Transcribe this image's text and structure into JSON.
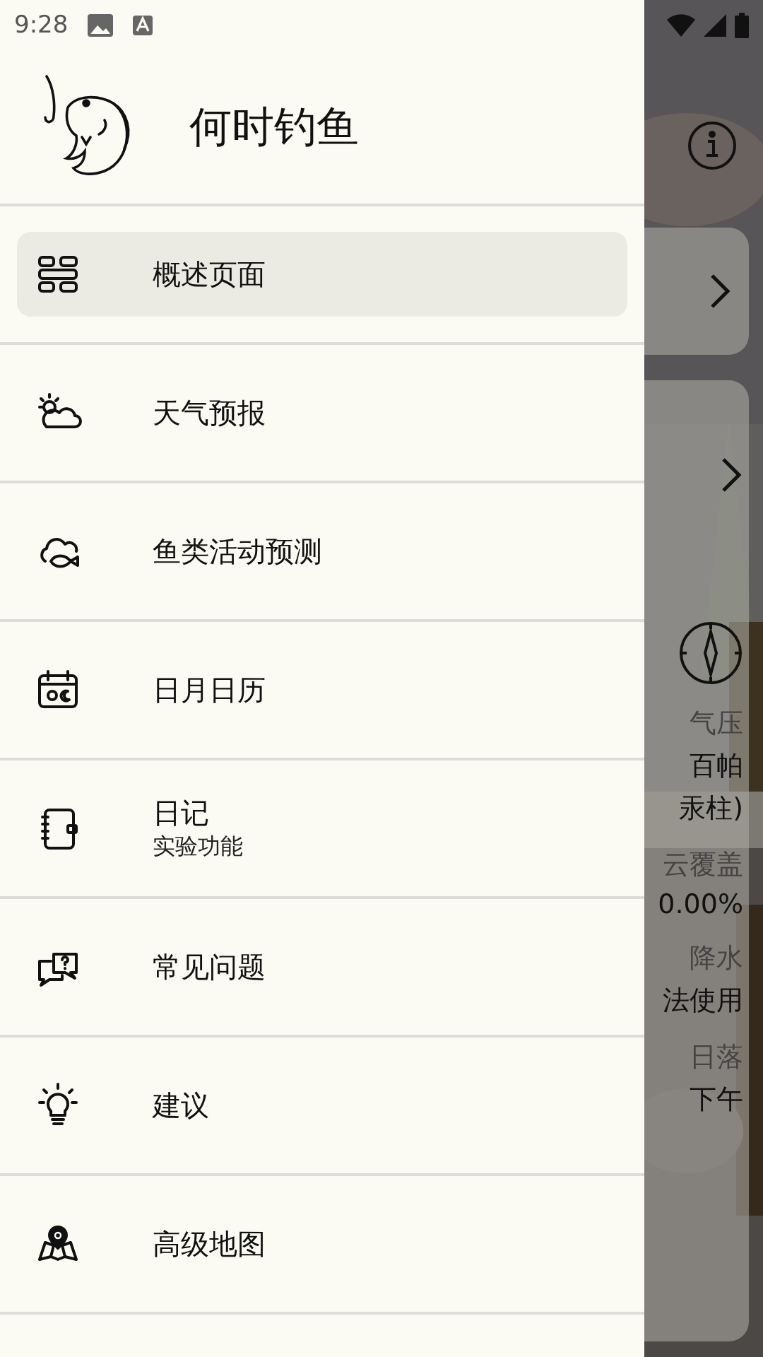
{
  "status_bar": {
    "time": "9:28"
  },
  "drawer": {
    "app_name": "何时钓鱼",
    "items": [
      {
        "kind": "grid",
        "label": "概述页面",
        "selected": true
      },
      {
        "kind": "weather",
        "label": "天气预报",
        "selected": false
      },
      {
        "kind": "fish-cloud",
        "label": "鱼类活动预测",
        "selected": false
      },
      {
        "kind": "calendar",
        "label": "日月日历",
        "selected": false
      },
      {
        "kind": "notebook",
        "label": "日记",
        "sublabel": "实验功能",
        "selected": false
      },
      {
        "kind": "faq",
        "label": "常见问题",
        "selected": false
      },
      {
        "kind": "bulb",
        "label": "建议",
        "selected": false
      },
      {
        "kind": "map",
        "label": "高级地图",
        "selected": false
      }
    ]
  },
  "background": {
    "readings": [
      {
        "label": "气压",
        "value": "百帕",
        "value_2": "汞柱)"
      },
      {
        "label": "云覆盖",
        "value": "0.00%"
      },
      {
        "label": "降水",
        "value": "法使用"
      },
      {
        "label": "日落",
        "value": "下午"
      }
    ]
  }
}
